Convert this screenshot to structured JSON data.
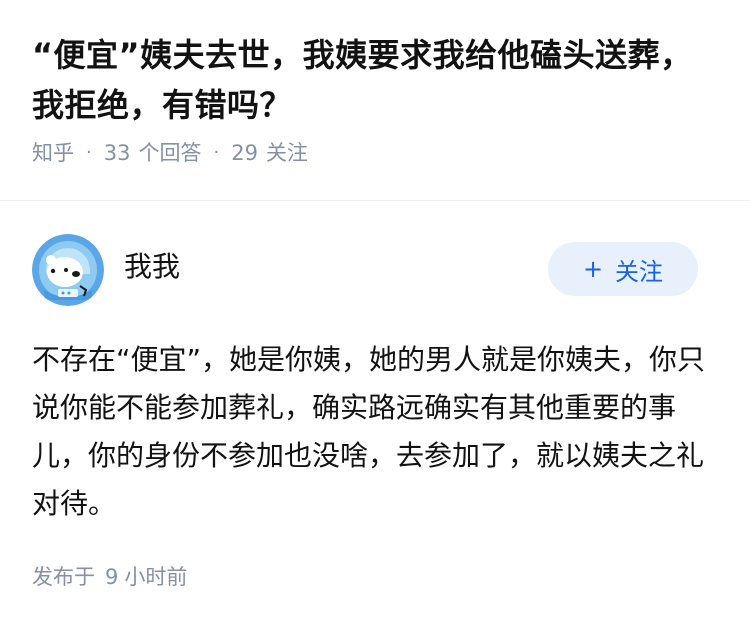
{
  "question": {
    "title": "“便宜”姨夫去世，我姨要求我给他磕头送葬，我拒绝，有错吗？",
    "source": "知乎",
    "answer_count": "33",
    "answer_label": "个回答",
    "follower_count": "29",
    "follower_label": "关注",
    "separator": "·"
  },
  "author": {
    "name": "我我",
    "avatar_icon": "polar-bear-astronaut-avatar",
    "follow_plus": "+",
    "follow_label": "关注"
  },
  "answer": {
    "content": "不存在“便宜”，她是你姨，她的男人就是你姨夫，你只说你能不能参加葬礼，确实路远确实有其他重要的事儿，你的身份不参加也没啥，去参加了，就以姨夫之礼对待。"
  },
  "published": {
    "prefix": "发布于",
    "value": "9",
    "unit": "小时前"
  },
  "colors": {
    "text": "#121212",
    "meta": "#8590a6",
    "brand": "#1763e6",
    "button_bg": "#e8f0fb",
    "divider": "#eef0f4"
  }
}
